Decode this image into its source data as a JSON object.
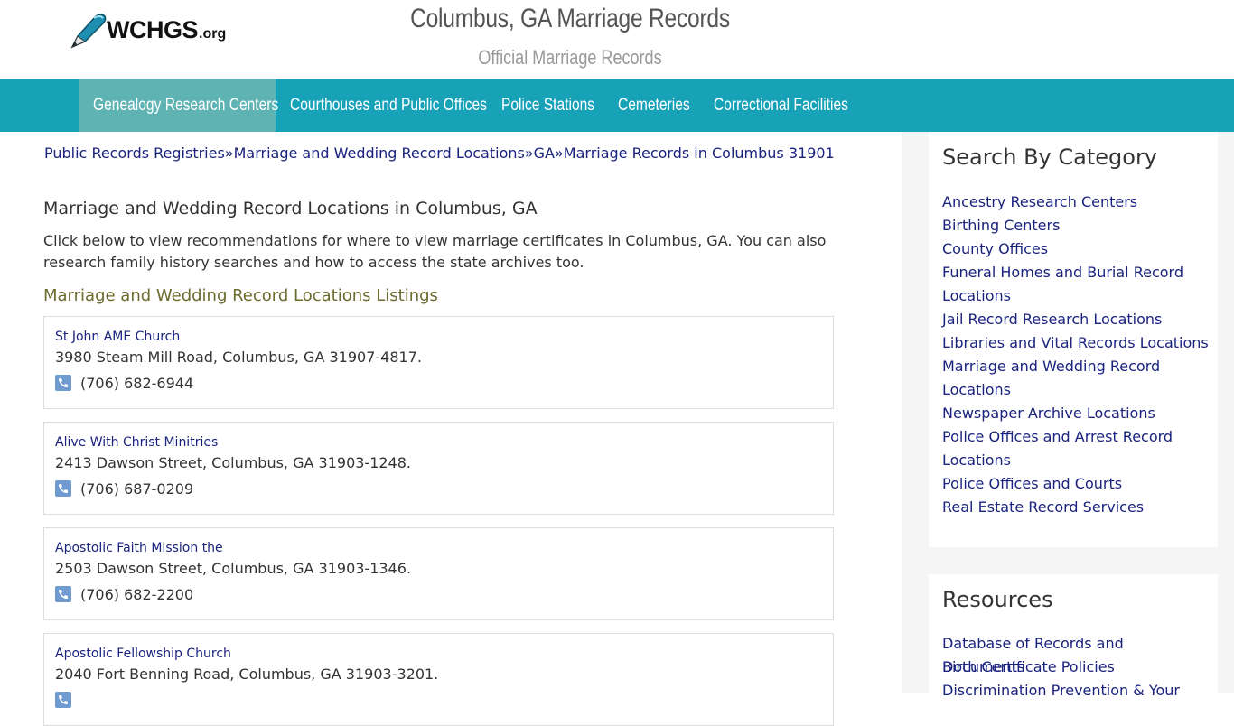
{
  "header": {
    "logo_text": "WCHGS",
    "logo_suffix": ".org",
    "title": "Columbus, GA Marriage Records",
    "subtitle": "Official Marriage Records"
  },
  "nav": {
    "items": [
      {
        "label": "Genealogy Research Centers"
      },
      {
        "label": "Courthouses and Public Offices"
      },
      {
        "label": "Police Stations"
      },
      {
        "label": "Cemeteries"
      },
      {
        "label": "Correctional Facilities"
      }
    ],
    "active_color": "#5fb3b3",
    "bar_color": "#17a2b8"
  },
  "breadcrumb": {
    "items": [
      "Public Records Registries",
      "Marriage and Wedding Record Locations",
      "GA",
      "Marriage Records in Columbus 31901"
    ],
    "separator": "»"
  },
  "main": {
    "heading": "Marriage and Wedding Record Locations in Columbus, GA",
    "intro": "Click below to view recommendations for where to view marriage certificates in Columbus, GA. You can also research family history searches and how to access the state archives too.",
    "listings_heading": "Marriage and Wedding Record Locations Listings",
    "listings": [
      {
        "name": "St John AME Church",
        "address": "3980 Steam Mill Road, Columbus, GA 31907-4817.",
        "phone": "(706) 682-6944"
      },
      {
        "name": "Alive With Christ Minitries",
        "address": "2413 Dawson Street, Columbus, GA 31903-1248.",
        "phone": "(706) 687-0209"
      },
      {
        "name": "Apostolic Faith Mission the",
        "address": "2503 Dawson Street, Columbus, GA 31903-1346.",
        "phone": "(706) 682-2200"
      },
      {
        "name": "Apostolic Fellowship Church",
        "address": "2040 Fort Benning Road, Columbus, GA 31903-3201.",
        "phone": ""
      }
    ]
  },
  "sidebar": {
    "category_title": "Search By Category",
    "categories": [
      "Ancestry Research Centers",
      "Birthing Centers",
      "County Offices",
      "Funeral Homes and Burial Record Locations",
      "Jail Record Research Locations",
      "Libraries and Vital Records Locations",
      "Marriage and Wedding Record Locations",
      "Newspaper Archive Locations",
      "Police Offices and Arrest Record Locations",
      "Police Offices and Courts",
      "Real Estate Record Services"
    ],
    "resources_title": "Resources",
    "resources": [
      "Database of Records and Documents",
      "Birth Certificate Policies",
      "Discrimination Prevention & Your"
    ]
  }
}
